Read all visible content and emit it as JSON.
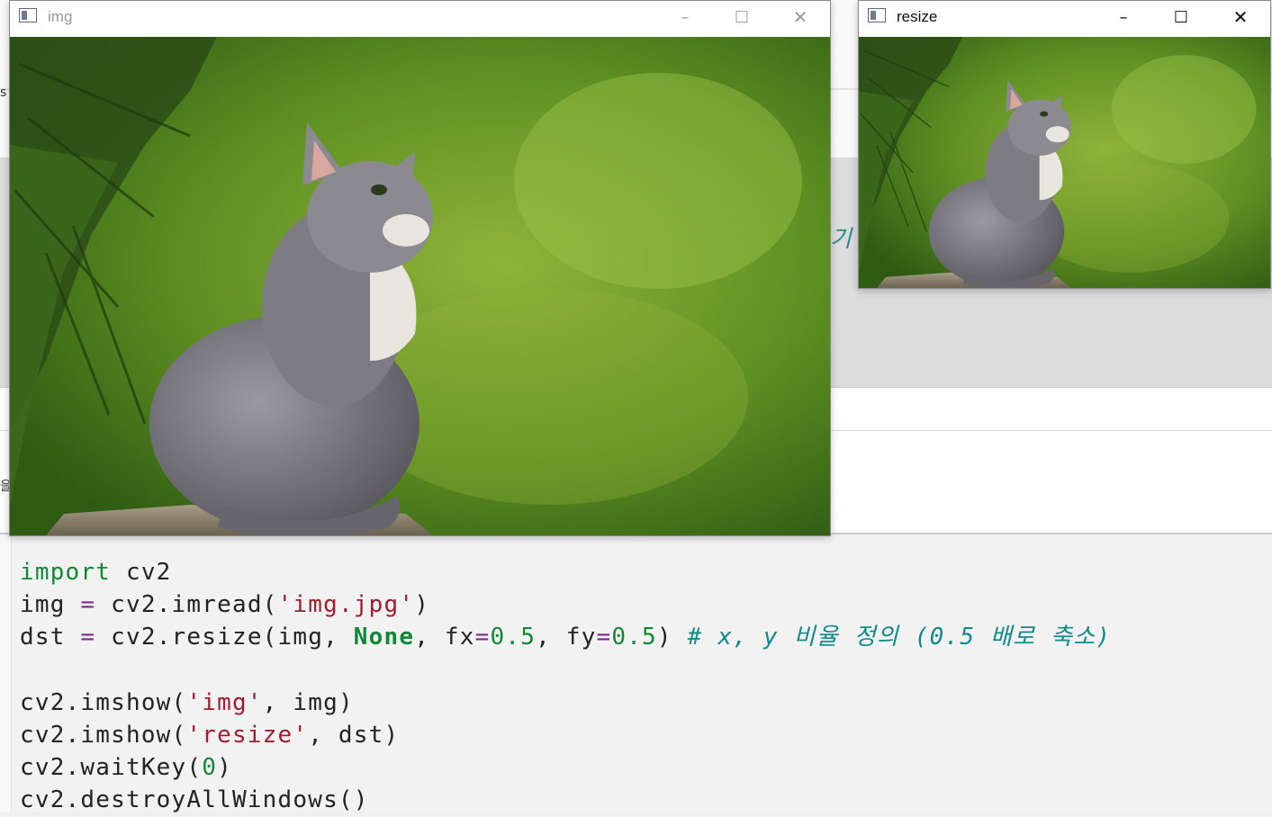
{
  "background_app": {
    "partial_text_korean": "기",
    "left_edge_char_1": "s",
    "left_edge_char_2": "을"
  },
  "windows": {
    "img": {
      "title": "img",
      "controls": {
        "minimize": "–",
        "maximize": "☐",
        "close": "✕"
      }
    },
    "resize": {
      "title": "resize",
      "controls": {
        "minimize": "–",
        "maximize": "☐",
        "close": "✕"
      }
    }
  },
  "code": {
    "lines": [
      [
        {
          "t": "import",
          "c": "kw"
        },
        {
          "t": " cv2",
          "c": ""
        }
      ],
      [
        {
          "t": "img ",
          "c": ""
        },
        {
          "t": "=",
          "c": "op"
        },
        {
          "t": " cv2.imread(",
          "c": ""
        },
        {
          "t": "'img.jpg'",
          "c": "str"
        },
        {
          "t": ")",
          "c": ""
        }
      ],
      [
        {
          "t": "dst ",
          "c": ""
        },
        {
          "t": "=",
          "c": "op"
        },
        {
          "t": " cv2.resize(img, ",
          "c": ""
        },
        {
          "t": "None",
          "c": "none"
        },
        {
          "t": ", fx",
          "c": ""
        },
        {
          "t": "=",
          "c": "op"
        },
        {
          "t": "0.5",
          "c": "num"
        },
        {
          "t": ", fy",
          "c": ""
        },
        {
          "t": "=",
          "c": "op"
        },
        {
          "t": "0.5",
          "c": "num"
        },
        {
          "t": ") ",
          "c": ""
        },
        {
          "t": "# x, y 비율 정의 (0.5 배로 축소)",
          "c": "cmt"
        }
      ],
      [],
      [
        {
          "t": "cv2.imshow(",
          "c": ""
        },
        {
          "t": "'img'",
          "c": "str"
        },
        {
          "t": ", img)",
          "c": ""
        }
      ],
      [
        {
          "t": "cv2.imshow(",
          "c": ""
        },
        {
          "t": "'resize'",
          "c": "str"
        },
        {
          "t": ", dst)",
          "c": ""
        }
      ],
      [
        {
          "t": "cv2.waitKey(",
          "c": ""
        },
        {
          "t": "0",
          "c": "num"
        },
        {
          "t": ")",
          "c": ""
        }
      ],
      [
        {
          "t": "cv2.destroyAllWindows()",
          "c": ""
        }
      ]
    ]
  },
  "colors": {
    "keyword": "#118838",
    "string": "#a11c2c",
    "comment": "#108a8a",
    "operator": "#7a2a8a"
  },
  "icons": [
    "window-app-icon",
    "minimize-icon",
    "maximize-icon",
    "close-icon"
  ]
}
